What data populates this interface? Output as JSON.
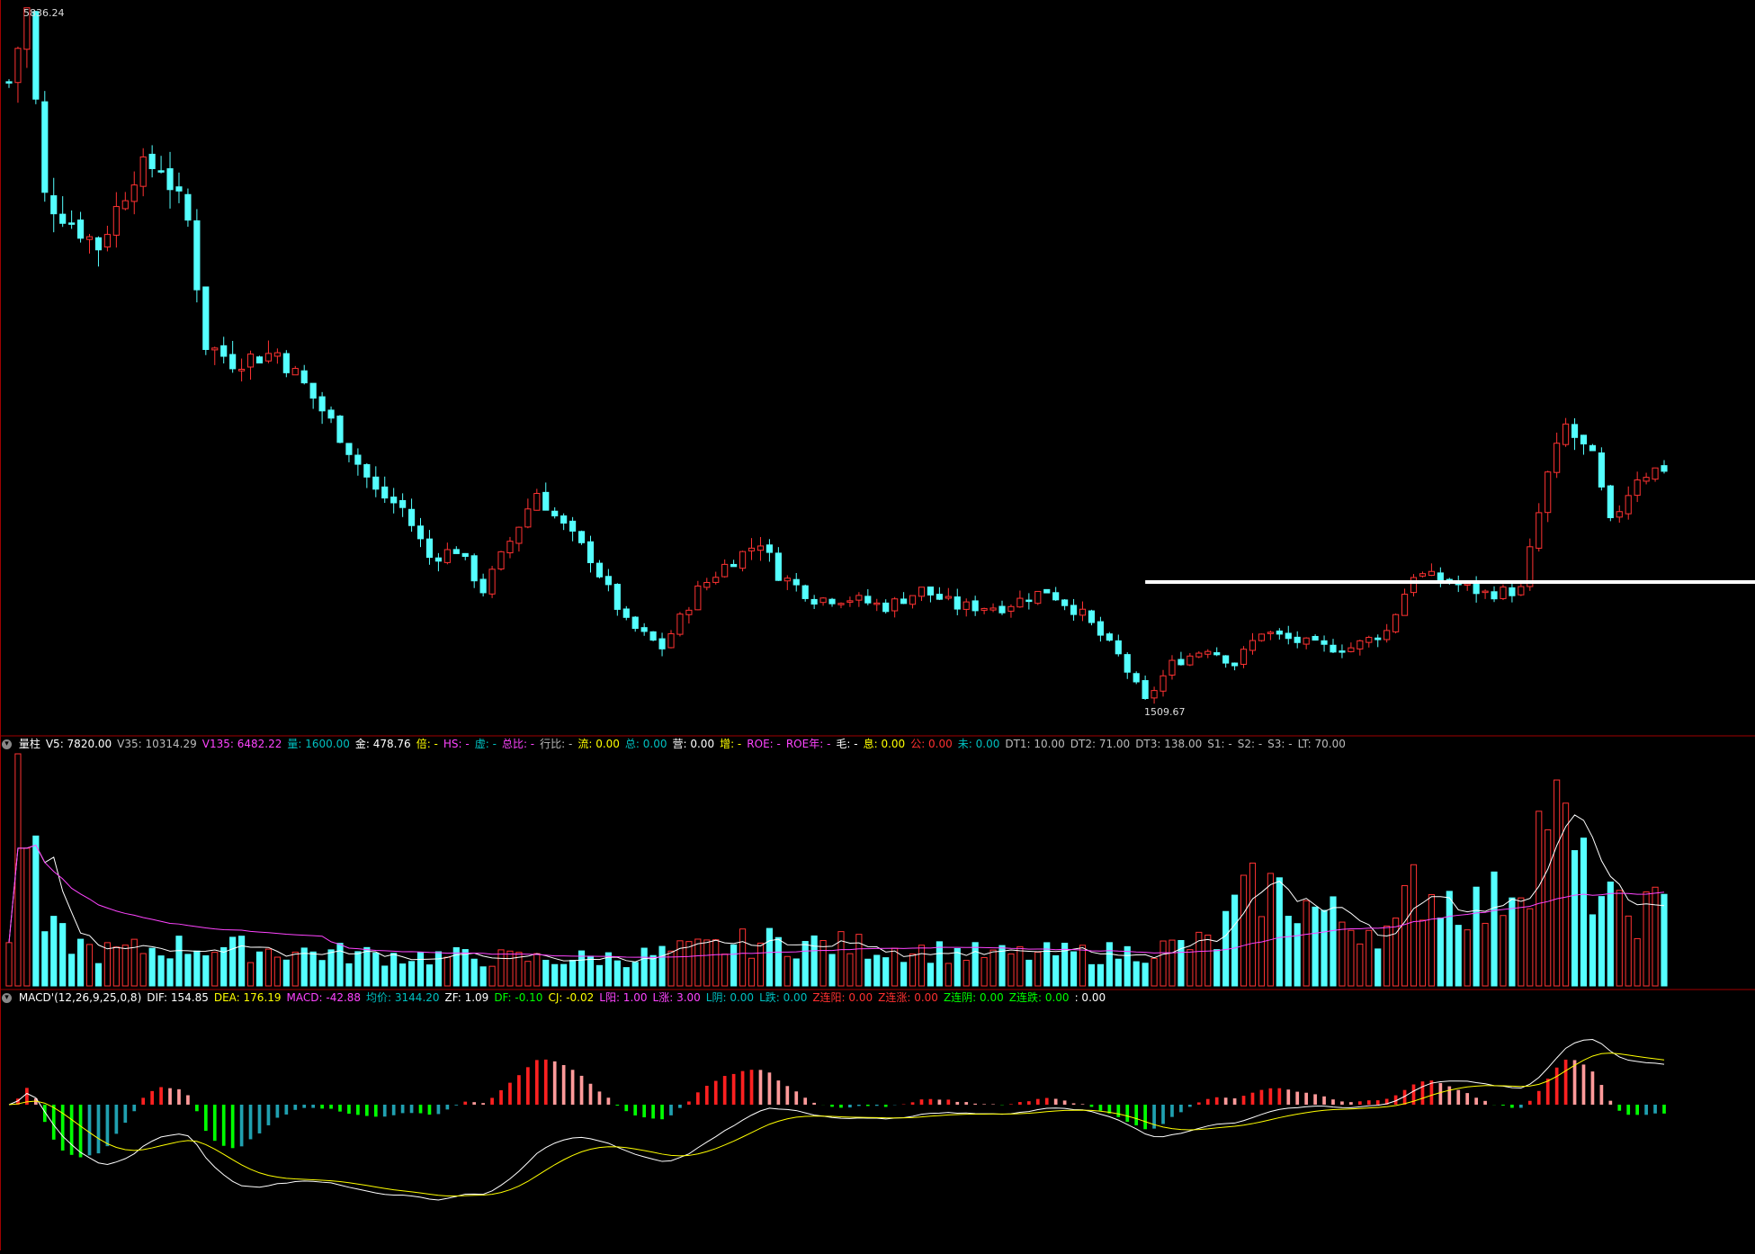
{
  "price_panel": {
    "max_label": "5836.24",
    "min_label": "1509.67",
    "support_line_level": 2350
  },
  "volume_panel": {
    "header": [
      {
        "text": "量柱",
        "color": "#ffffff"
      },
      {
        "text": "V5: 7820.00",
        "color": "#ffffff"
      },
      {
        "text": "V35: 10314.29",
        "color": "#bbbbbb"
      },
      {
        "text": "V135: 6482.22",
        "color": "#ff44ff"
      },
      {
        "text": "量: 1600.00",
        "color": "#00c0c0"
      },
      {
        "text": "金: 478.76",
        "color": "#ffffff"
      },
      {
        "text": "倍: -",
        "color": "#ffff00"
      },
      {
        "text": "HS: -",
        "color": "#ff44ff"
      },
      {
        "text": "虚: -",
        "color": "#00c0c0"
      },
      {
        "text": "总比: -",
        "color": "#ff44ff"
      },
      {
        "text": "行比: -",
        "color": "#bbbbbb"
      },
      {
        "text": "流: 0.00",
        "color": "#ffff00"
      },
      {
        "text": "总: 0.00",
        "color": "#00c0c0"
      },
      {
        "text": "营: 0.00",
        "color": "#ffffff"
      },
      {
        "text": "增: -",
        "color": "#ffff00"
      },
      {
        "text": "ROE: -",
        "color": "#ff44ff"
      },
      {
        "text": "ROE年: -",
        "color": "#ff44ff"
      },
      {
        "text": "毛: -",
        "color": "#ffffff"
      },
      {
        "text": "息: 0.00",
        "color": "#ffff00"
      },
      {
        "text": "公: 0.00",
        "color": "#ff3030"
      },
      {
        "text": "未: 0.00",
        "color": "#00c0c0"
      },
      {
        "text": "DT1: 10.00",
        "color": "#bbbbbb"
      },
      {
        "text": "DT2: 71.00",
        "color": "#bbbbbb"
      },
      {
        "text": "DT3: 138.00",
        "color": "#bbbbbb"
      },
      {
        "text": "S1: -",
        "color": "#bbbbbb"
      },
      {
        "text": "S2: -",
        "color": "#bbbbbb"
      },
      {
        "text": "S3: -",
        "color": "#bbbbbb"
      },
      {
        "text": "LT: 70.00",
        "color": "#bbbbbb"
      }
    ]
  },
  "macd_panel": {
    "header": [
      {
        "text": "MACD'(12,26,9,25,0,8)",
        "color": "#ffffff"
      },
      {
        "text": "DIF: 154.85",
        "color": "#ffffff"
      },
      {
        "text": "DEA: 176.19",
        "color": "#ffff00"
      },
      {
        "text": "MACD: -42.88",
        "color": "#ff44ff"
      },
      {
        "text": "均价: 3144.20",
        "color": "#00c0c0"
      },
      {
        "text": "ZF: 1.09",
        "color": "#ffffff"
      },
      {
        "text": "DF: -0.10",
        "color": "#00ff00"
      },
      {
        "text": "CJ: -0.02",
        "color": "#ffff00"
      },
      {
        "text": "L阳: 1.00",
        "color": "#ff44ff"
      },
      {
        "text": "L涨: 3.00",
        "color": "#ff44ff"
      },
      {
        "text": "L阴: 0.00",
        "color": "#00c0c0"
      },
      {
        "text": "L跌: 0.00",
        "color": "#00c0c0"
      },
      {
        "text": "Z连阳: 0.00",
        "color": "#ff3030"
      },
      {
        "text": "Z连涨: 0.00",
        "color": "#ff3030"
      },
      {
        "text": "Z连阴: 0.00",
        "color": "#00ff00"
      },
      {
        "text": "Z连跌: 0.00",
        "color": "#00ff00"
      },
      {
        "text": ": 0.00",
        "color": "#ffffff"
      }
    ]
  },
  "colors": {
    "up": "#ff3232",
    "down": "#54ffff",
    "support_line": "#ffffff",
    "panel_separator": "#a00000",
    "dif_line": "#ffffff",
    "dea_line": "#ffff00",
    "macd_pos": "#ff2020",
    "macd_pos_fading": "#ff9a9a",
    "macd_neg": "#00ff00",
    "macd_neg_fading": "#20a0b0"
  },
  "chart_data": {
    "type": "candlestick",
    "bars": 186,
    "price_max": 5836.24,
    "price_min": 1509.67,
    "anchors": [
      [
        0,
        5400
      ],
      [
        2,
        5836
      ],
      [
        4,
        4700
      ],
      [
        10,
        4400
      ],
      [
        14,
        4850
      ],
      [
        17,
        4900
      ],
      [
        20,
        4550
      ],
      [
        22,
        3800
      ],
      [
        25,
        3700
      ],
      [
        30,
        3750
      ],
      [
        33,
        3550
      ],
      [
        37,
        3250
      ],
      [
        41,
        2900
      ],
      [
        44,
        2800
      ],
      [
        47,
        2500
      ],
      [
        50,
        2550
      ],
      [
        53,
        2300
      ],
      [
        56,
        2600
      ],
      [
        59,
        2900
      ],
      [
        61,
        2750
      ],
      [
        65,
        2500
      ],
      [
        69,
        2100
      ],
      [
        73,
        1950
      ],
      [
        77,
        2300
      ],
      [
        80,
        2450
      ],
      [
        84,
        2600
      ],
      [
        86,
        2400
      ],
      [
        90,
        2250
      ],
      [
        94,
        2250
      ],
      [
        98,
        2200
      ],
      [
        102,
        2300
      ],
      [
        106,
        2200
      ],
      [
        111,
        2200
      ],
      [
        116,
        2300
      ],
      [
        120,
        2150
      ],
      [
        124,
        1900
      ],
      [
        127,
        1620
      ],
      [
        130,
        1850
      ],
      [
        134,
        1950
      ],
      [
        137,
        1850
      ],
      [
        140,
        2050
      ],
      [
        143,
        2000
      ],
      [
        147,
        1950
      ],
      [
        150,
        1950
      ],
      [
        154,
        2050
      ],
      [
        157,
        2400
      ],
      [
        161,
        2350
      ],
      [
        165,
        2280
      ],
      [
        169,
        2300
      ],
      [
        172,
        3000
      ],
      [
        174,
        3300
      ],
      [
        177,
        3100
      ],
      [
        179,
        2700
      ],
      [
        182,
        3000
      ],
      [
        185,
        3050
      ]
    ],
    "volume_level": [
      [
        0,
        0.2
      ],
      [
        1,
        1.0
      ],
      [
        4,
        0.25
      ],
      [
        10,
        0.15
      ],
      [
        20,
        0.18
      ],
      [
        40,
        0.14
      ],
      [
        60,
        0.12
      ],
      [
        70,
        0.13
      ],
      [
        84,
        0.2
      ],
      [
        95,
        0.18
      ],
      [
        110,
        0.14
      ],
      [
        125,
        0.15
      ],
      [
        135,
        0.2
      ],
      [
        137,
        0.35
      ],
      [
        140,
        0.45
      ],
      [
        150,
        0.28
      ],
      [
        155,
        0.25
      ],
      [
        157,
        0.45
      ],
      [
        165,
        0.35
      ],
      [
        170,
        0.55
      ],
      [
        172,
        0.85
      ],
      [
        176,
        0.5
      ],
      [
        180,
        0.32
      ],
      [
        185,
        0.35
      ]
    ]
  }
}
